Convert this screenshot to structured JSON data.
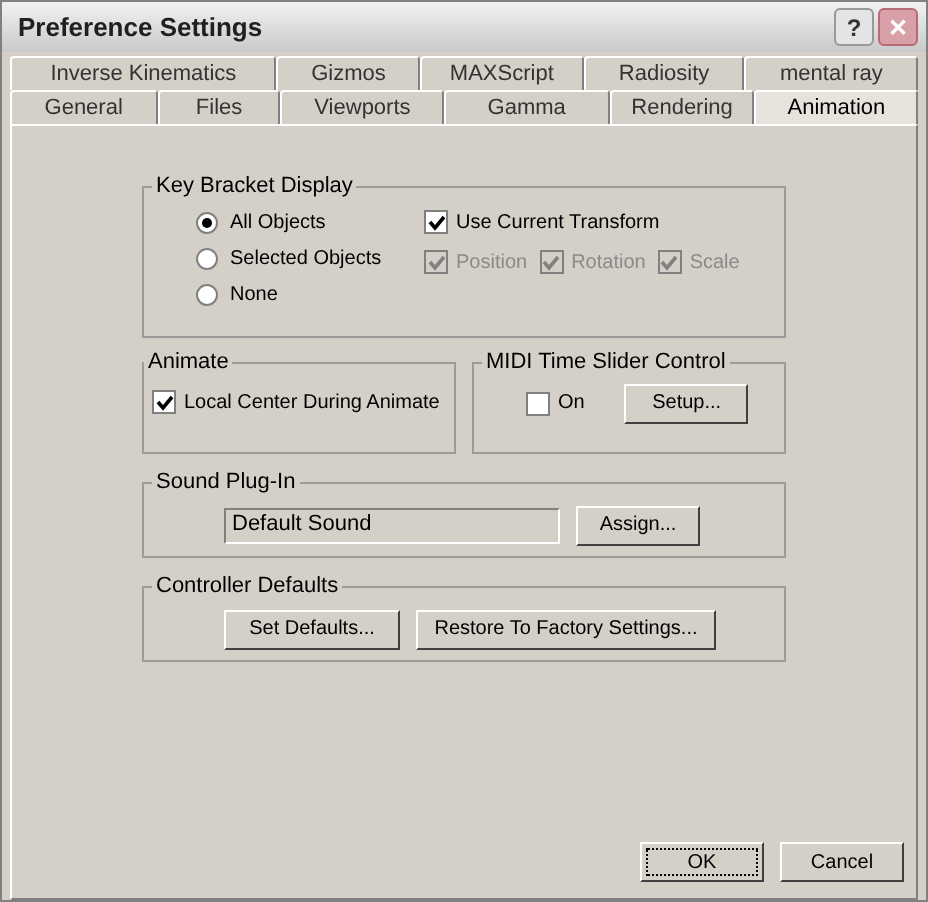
{
  "window": {
    "title": "Preference Settings",
    "controls": [
      {
        "kind": "help",
        "label": "?"
      },
      {
        "kind": "close",
        "label": "✕"
      }
    ]
  },
  "tab_rows": [
    [
      {
        "label": "Inverse Kinematics",
        "selected": false
      },
      {
        "label": "Gizmos",
        "selected": false
      },
      {
        "label": "MAXScript",
        "selected": false
      },
      {
        "label": "Radiosity",
        "selected": false
      },
      {
        "label": "mental ray",
        "selected": false
      }
    ],
    [
      {
        "label": "General",
        "selected": false
      },
      {
        "label": "Files",
        "selected": false
      },
      {
        "label": "Viewports",
        "selected": false
      },
      {
        "label": "Gamma",
        "selected": false
      },
      {
        "label": "Rendering",
        "selected": false
      },
      {
        "label": "Animation",
        "selected": true
      }
    ]
  ],
  "key_bracket_display": {
    "title": "Key Bracket Display",
    "radios": [
      {
        "label": "All Objects",
        "selected": true
      },
      {
        "label": "Selected Objects",
        "selected": false
      },
      {
        "label": "None",
        "selected": false
      }
    ],
    "use_current_transform": {
      "label": "Use Current Transform",
      "checked": true,
      "disabled": false
    },
    "transform_checks": [
      {
        "label": "Position",
        "checked": true,
        "disabled": true
      },
      {
        "label": "Rotation",
        "checked": true,
        "disabled": true
      },
      {
        "label": "Scale",
        "checked": true,
        "disabled": true
      }
    ]
  },
  "animate": {
    "title": "Animate",
    "checkbox": {
      "label": "Local Center During Animate",
      "checked": true,
      "disabled": false
    }
  },
  "midi": {
    "title": "MIDI Time Slider Control",
    "checkbox": {
      "label": "On",
      "checked": false,
      "disabled": false
    },
    "button": "Setup..."
  },
  "sound_plugin": {
    "title": "Sound Plug-In",
    "value": "Default Sound",
    "button": "Assign..."
  },
  "controller_defaults": {
    "title": "Controller Defaults",
    "buttons": [
      "Set Defaults...",
      "Restore To Factory Settings..."
    ]
  },
  "footer_buttons": [
    {
      "label": "OK",
      "focused": true
    },
    {
      "label": "Cancel",
      "focused": false
    }
  ]
}
